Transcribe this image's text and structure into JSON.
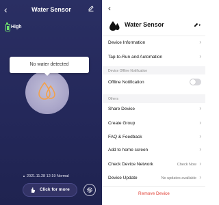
{
  "left": {
    "title": "Water Sensor",
    "battery_level": "High",
    "message": "No water detected",
    "status_line": "2021.11.28 12:19 Normal",
    "click_button": "Click for more"
  },
  "right": {
    "device_name": "Water Sensor",
    "menu": {
      "device_information": "Device Information",
      "tap_to_run": "Tap-to-Run and Automation"
    },
    "offline_section": {
      "header": "Device Offline Notification",
      "offline_label": "Offline Notification",
      "offline_enabled": false
    },
    "others_section": {
      "header": "Others",
      "items": [
        "Share Device",
        "Create Group",
        "FAQ & Feedback",
        "Add to home screen"
      ]
    },
    "network": {
      "label": "Check Device Network",
      "value": "Check Now"
    },
    "update": {
      "label": "Device Update",
      "value": "No updates available"
    },
    "remove": "Remove Device"
  },
  "icons": {
    "back": "back-chevron-icon",
    "edit": "pencil-edit-icon",
    "drop": "water-drop-icon",
    "battery": "battery-icon",
    "gear": "gear-icon",
    "chevron": "chevron-right-icon",
    "click": "pointer-hand-icon"
  },
  "colors": {
    "left_bg": "#25295c",
    "accent_orange": "#f2a04a",
    "battery_green": "#6ee06e",
    "remove_red": "#e03c31"
  }
}
